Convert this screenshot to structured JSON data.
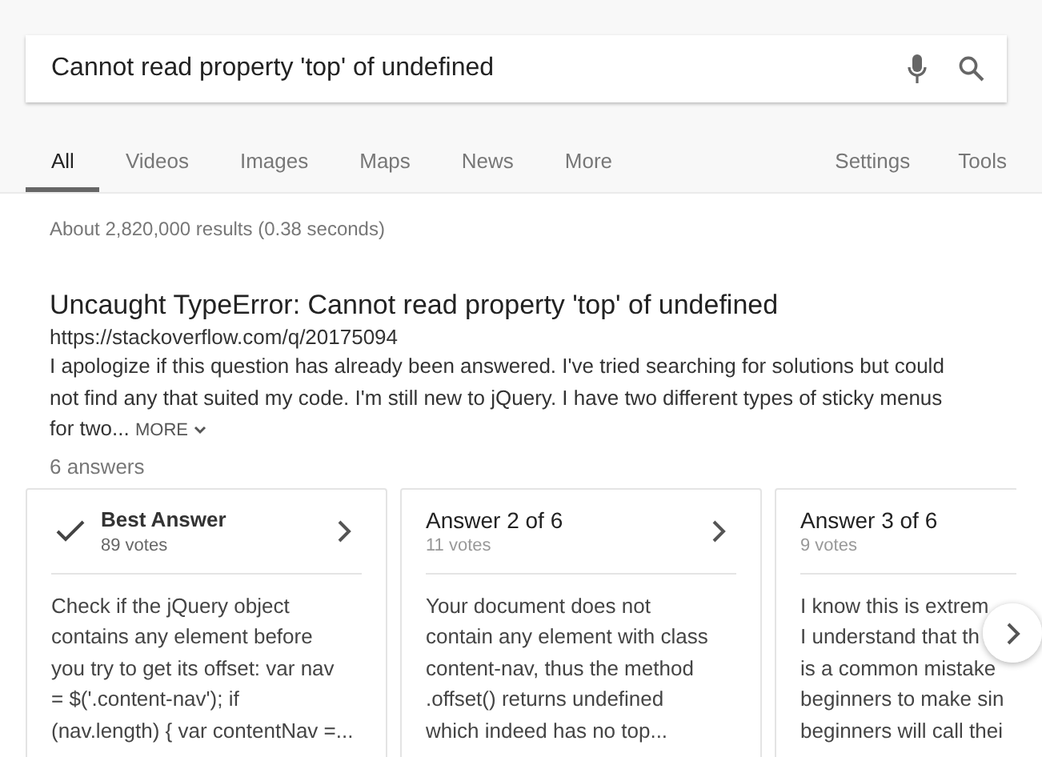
{
  "search": {
    "value": "Cannot read property 'top' of undefined"
  },
  "tabs": [
    {
      "label": "All",
      "selected": true
    },
    {
      "label": "Videos",
      "selected": false
    },
    {
      "label": "Images",
      "selected": false
    },
    {
      "label": "Maps",
      "selected": false
    },
    {
      "label": "News",
      "selected": false
    },
    {
      "label": "More",
      "selected": false
    }
  ],
  "tools": [
    "Settings",
    "Tools"
  ],
  "stats": "About 2,820,000 results (0.38 seconds)",
  "result": {
    "title": "Uncaught TypeError: Cannot read property 'top' of undefined",
    "url": "https://stackoverflow.com/q/20175094",
    "snippet": "I apologize if this question has already been answered. I've tried searching for solutions but could not find any that suited my code. I'm still new to jQuery. I have two different types of sticky menus for two...",
    "more": "MORE",
    "answers_count": "6 answers"
  },
  "answers": [
    {
      "kind": "best",
      "title": "Best Answer",
      "votes": "89 votes",
      "chevron": true,
      "lines": [
        "Check if the jQuery object",
        "contains any element before",
        "you try to get its offset: var nav",
        "= $('.content-nav'); if",
        "(nav.length) { var contentNav =..."
      ]
    },
    {
      "kind": "answer",
      "title": "Answer 2 of 6",
      "votes": "11 votes",
      "chevron": true,
      "lines": [
        "Your document does not",
        "contain any element with class",
        "content-nav, thus the method",
        ".offset() returns undefined",
        "which indeed has no top..."
      ]
    },
    {
      "kind": "answer",
      "title": "Answer 3 of 6",
      "votes": "9 votes",
      "chevron": false,
      "lines": [
        "I know this is extrem",
        "I understand that th",
        "is a common mistake",
        "beginners to make sin",
        "beginners will call thei"
      ]
    }
  ]
}
